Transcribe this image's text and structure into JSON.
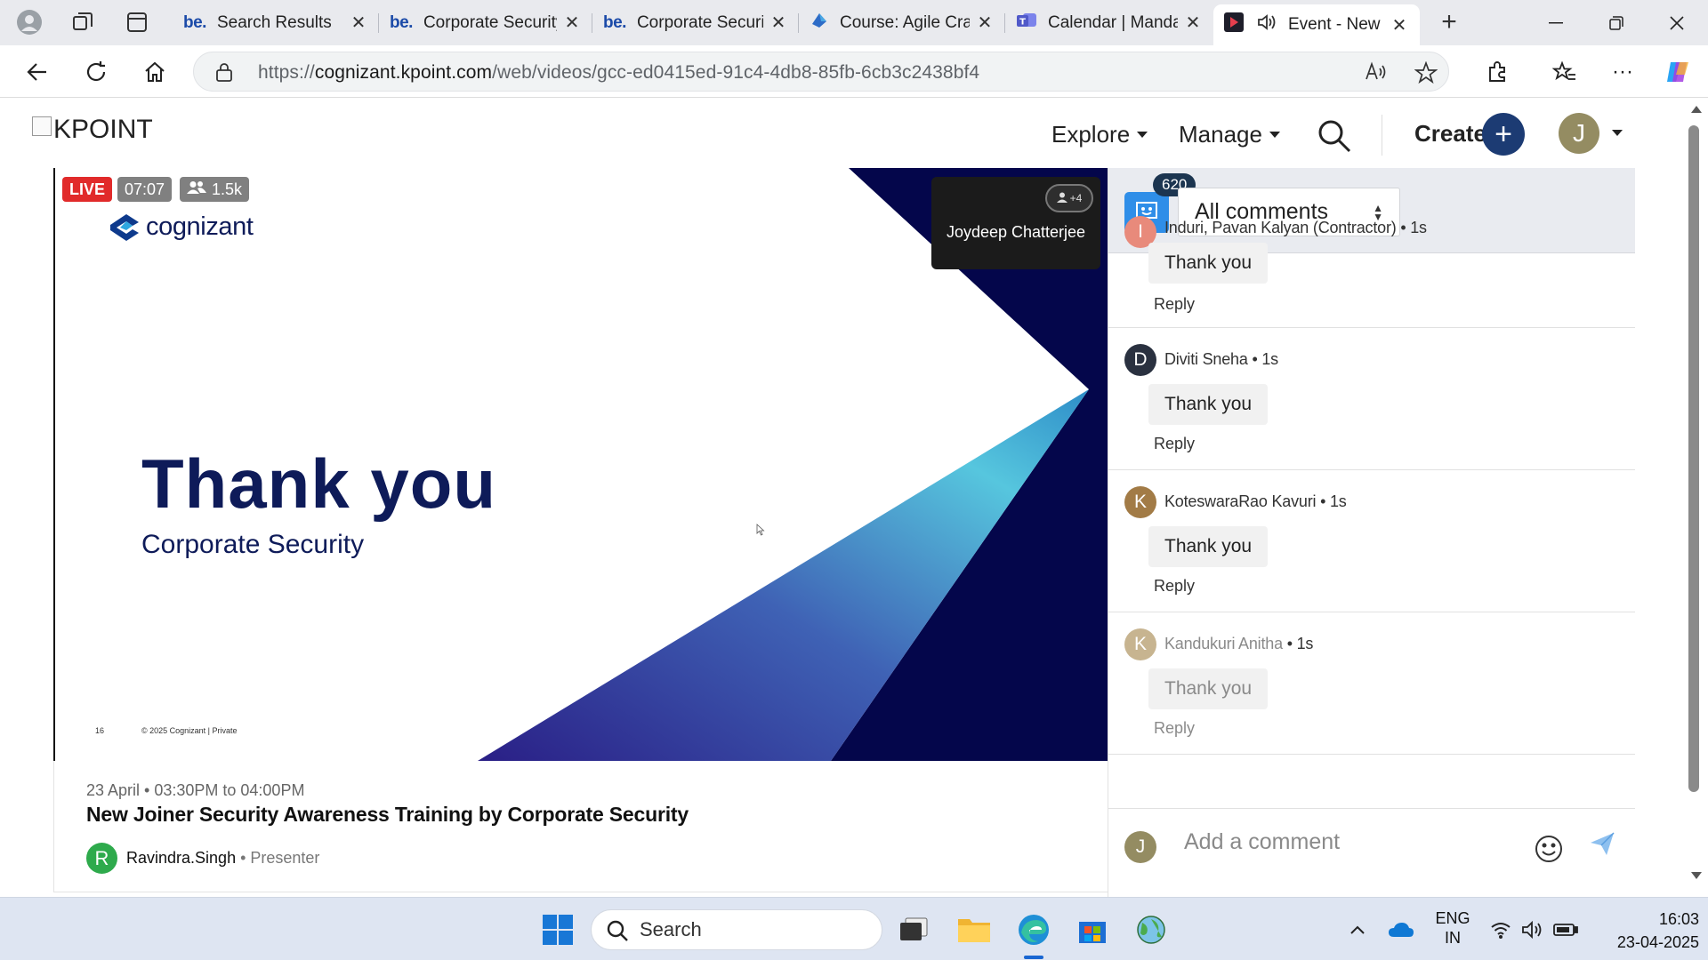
{
  "browser": {
    "tabs": [
      {
        "title": "Search Results",
        "icon": "be-icon"
      },
      {
        "title": "Corporate Security",
        "icon": "be-icon"
      },
      {
        "title": "Corporate Security",
        "icon": "be-icon"
      },
      {
        "title": "Course: Agile Craft",
        "icon": "course-icon"
      },
      {
        "title": "Calendar | Mandatory",
        "icon": "teams-icon"
      },
      {
        "title": "Event - New",
        "icon": "kpoint-icon",
        "active": true
      }
    ],
    "be_label": "be.",
    "url_prefix": "https://",
    "url_domain": "cognizant.kpoint.com",
    "url_path": "/web/videos/gcc-ed0415ed-91c4-4db8-85fb-6cb3c2438bf4"
  },
  "header": {
    "logo_text": "KPOINT",
    "nav": [
      {
        "label": "Explore"
      },
      {
        "label": "Manage"
      }
    ],
    "create_label": "Create",
    "user_initial": "J"
  },
  "video": {
    "badges": {
      "live": "LIVE",
      "time": "07:07",
      "viewers": "1.5k"
    },
    "slide": {
      "brand": "cognizant",
      "title": "Thank you",
      "subtitle": "Corporate Security",
      "page_number": "16",
      "copyright": "© 2025 Cognizant | Private"
    },
    "presenter_tile": {
      "name": "Joydeep Chatterjee",
      "participants": "+4"
    }
  },
  "event": {
    "date": "23 April • 03:30PM to 04:00PM",
    "title": "New Joiner Security Awareness Training by Corporate Security",
    "presenter_initial": "R",
    "presenter_name": "Ravindra.Singh",
    "presenter_role": " • Presenter"
  },
  "comments": {
    "count": "620",
    "filter": "All comments",
    "items": [
      {
        "initial": "I",
        "name": "Induri, Pavan Kalyan (Contractor)",
        "ago": " • 1s",
        "text": "Thank you",
        "reply": "Reply",
        "color": "#e88a7b"
      },
      {
        "initial": "D",
        "name": "Diviti Sneha",
        "ago": " • 1s",
        "text": "Thank you",
        "reply": "Reply",
        "color": "#2a3140"
      },
      {
        "initial": "K",
        "name": "KoteswaraRao Kavuri",
        "ago": " • 1s",
        "text": "Thank you",
        "reply": "Reply",
        "color": "#a27b46"
      },
      {
        "initial": "K",
        "name": "Kandukuri Anitha",
        "ago": " • 1s",
        "text": "Thank you",
        "reply": "Reply",
        "color": "#c7b490"
      }
    ],
    "compose_initial": "J",
    "compose_placeholder": "Add a comment"
  },
  "taskbar": {
    "search_label": "Search",
    "lang_top": "ENG",
    "lang_bottom": "IN",
    "time": "16:03",
    "date": "23-04-2025"
  },
  "colors": {
    "brand_navy": "#0e1b59",
    "live_red": "#e12a2a",
    "create_blue": "#1c3b73",
    "chat_blue": "#2f8ee8"
  }
}
